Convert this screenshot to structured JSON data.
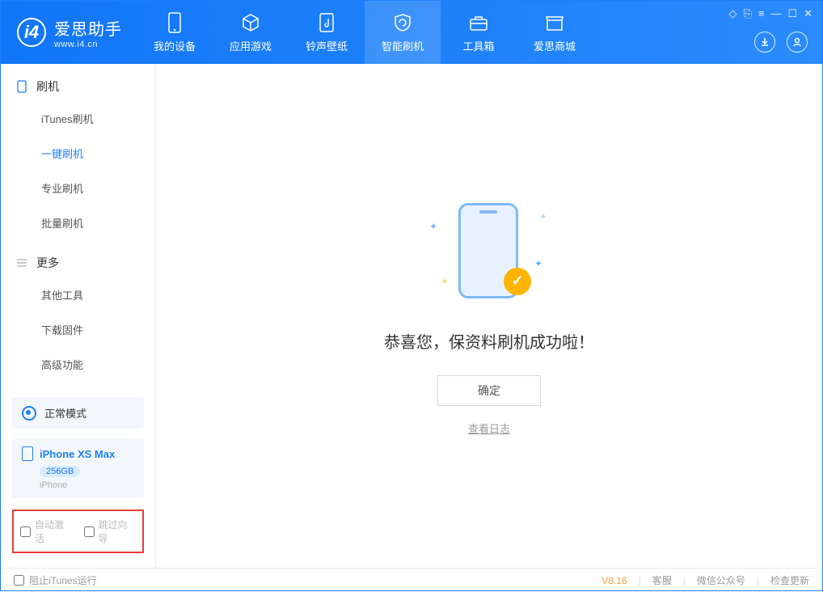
{
  "app": {
    "name_cn": "爱思助手",
    "url": "www.i4.cn"
  },
  "nav": [
    {
      "label": "我的设备"
    },
    {
      "label": "应用游戏"
    },
    {
      "label": "铃声壁纸"
    },
    {
      "label": "智能刷机"
    },
    {
      "label": "工具箱"
    },
    {
      "label": "爱思商城"
    }
  ],
  "sidebar": {
    "section1_title": "刷机",
    "items1": [
      {
        "label": "iTunes刷机"
      },
      {
        "label": "一键刷机"
      },
      {
        "label": "专业刷机"
      },
      {
        "label": "批量刷机"
      }
    ],
    "section2_title": "更多",
    "items2": [
      {
        "label": "其他工具"
      },
      {
        "label": "下载固件"
      },
      {
        "label": "高级功能"
      }
    ]
  },
  "mode": {
    "label": "正常模式"
  },
  "device": {
    "name": "iPhone XS Max",
    "capacity": "256GB",
    "type": "iPhone"
  },
  "options": {
    "auto_activate": "自动激活",
    "skip_guide": "跳过向导"
  },
  "main": {
    "title": "恭喜您，保资料刷机成功啦！",
    "ok": "确定",
    "view_log": "查看日志"
  },
  "footer": {
    "block_itunes": "阻止iTunes运行",
    "version": "V8.16",
    "service": "客服",
    "wechat": "微信公众号",
    "check_update": "检查更新"
  }
}
